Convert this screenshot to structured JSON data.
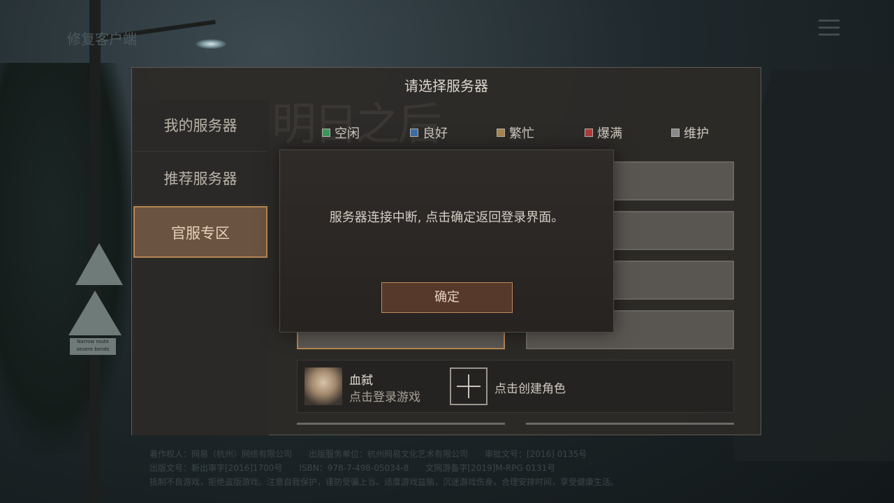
{
  "background": {
    "fix_client_label": "修复客户端",
    "sign_plate_text": "Narrow route severe bends",
    "footer_lines": [
      "著作权人：网易（杭州）网络有限公司　　出版服务单位：杭州网易文化艺术有限公司　　审批文号：[2016] 0135号",
      "出版文号：新出审字[2016]1700号　　ISBN：978-7-498-05034-8　　文网游备字[2019]M-RPG 0131号",
      "抵制不良游戏，拒绝盗版游戏。注意自我保护，谨防受骗上当。适度游戏益脑，沉迷游戏伤身。合理安排时间，享受健康生活。"
    ]
  },
  "server_panel": {
    "title": "请选择服务器",
    "watermark": "明日之后",
    "sidebar": [
      {
        "label": "我的服务器",
        "active": false
      },
      {
        "label": "推荐服务器",
        "active": false
      },
      {
        "label": "官服专区",
        "active": true
      }
    ],
    "legend": [
      {
        "label": "空闲",
        "color": "#3a9a5c"
      },
      {
        "label": "良好",
        "color": "#3d6fa8"
      },
      {
        "label": "繁忙",
        "color": "#a8884a"
      },
      {
        "label": "爆满",
        "color": "#b23a3a"
      },
      {
        "label": "维护",
        "color": "#8a8a8a"
      }
    ],
    "character": {
      "name": "血弑",
      "login_hint": "点击登录游戏",
      "create_label": "点击创建角色"
    }
  },
  "modal": {
    "message": "服务器连接中断, 点击确定返回登录界面。",
    "confirm_label": "确定"
  }
}
